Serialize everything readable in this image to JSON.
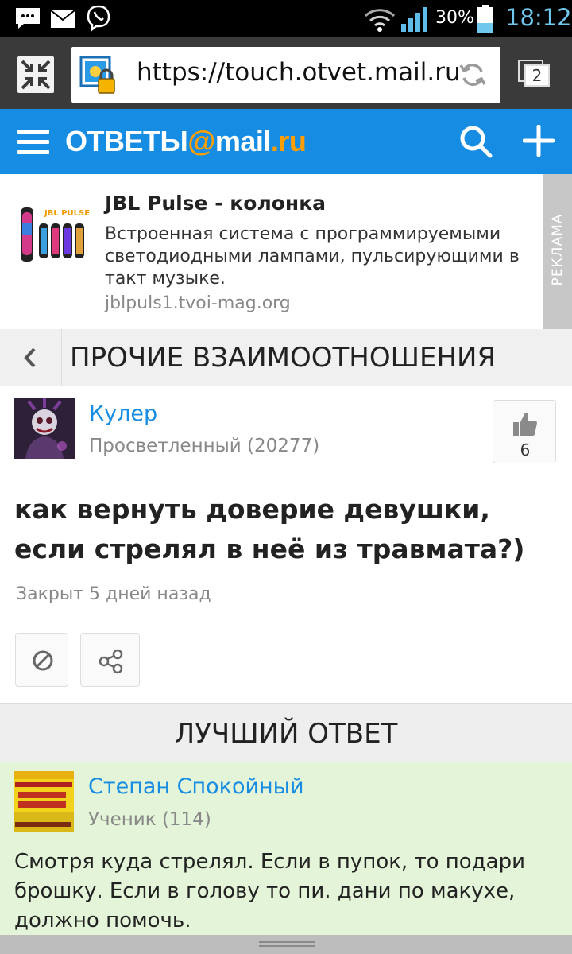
{
  "status_bar": {
    "battery": "30%",
    "time": "18:12"
  },
  "browser": {
    "url": "https://touch.otvet.mail.ru",
    "tab_count": "2"
  },
  "site": {
    "logo_prefix": "ОТВЕТЫ",
    "logo_at": "@",
    "logo_mail": "mail",
    "logo_dot": ".",
    "logo_ru": "ru"
  },
  "ad": {
    "title": "JBL Pulse - колонка",
    "description": "Встроенная система с программируемыми светодиодными лампами, пульсирующими в такт музыке.",
    "link": "jblpuls1.tvoi-mag.org",
    "label": "РЕКЛАМА",
    "image_text": "JBL PULSE"
  },
  "category": {
    "title": "ПРОЧИЕ ВЗАИМООТНОШЕНИЯ"
  },
  "question": {
    "author": "Кулер",
    "rank": "Просветленный (20277)",
    "likes": "6",
    "title": "как вернуть доверие девушки, если стрелял в неё из травмата?)",
    "status": "Закрыт 5 дней назад"
  },
  "best_answer": {
    "header": "ЛУЧШИЙ ОТВЕТ",
    "author": "Степан Спокойный",
    "rank": "Ученик (114)",
    "text": "Смотря куда стрелял. Если в пупок, то подари брошку. Если в голову то пи. дани по макухе, должно помочь."
  },
  "colors": {
    "brand_blue": "#168de2",
    "brand_orange": "#ff9e00",
    "answer_bg": "#e4f4d9"
  }
}
